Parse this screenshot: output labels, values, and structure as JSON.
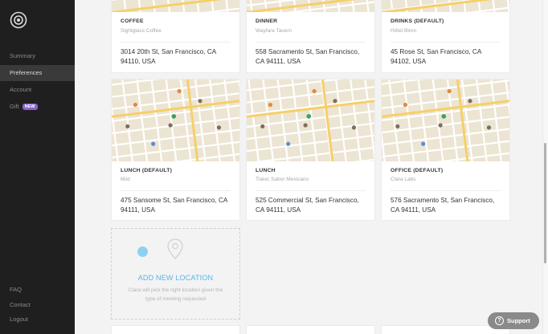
{
  "sidebar": {
    "items": [
      {
        "label": "Summary"
      },
      {
        "label": "Preferences"
      },
      {
        "label": "Account"
      },
      {
        "label": "Gift",
        "badge": "NEW"
      }
    ],
    "footer": [
      {
        "label": "FAQ"
      },
      {
        "label": "Contact"
      },
      {
        "label": "Logout"
      }
    ]
  },
  "locations": [
    {
      "title": "COFFEE",
      "name": "Sightglass Coffee",
      "address": "3014 20th St, San Francisco, CA 94110, USA"
    },
    {
      "title": "DINNER",
      "name": "Wayfare Tavern",
      "address": "558 Sacramento St, San Francisco, CA 94111, USA"
    },
    {
      "title": "DRINKS (DEFAULT)",
      "name": "Hôtel Biron",
      "address": "45 Rose St, San Francisco, CA 94102, USA"
    },
    {
      "title": "LUNCH (DEFAULT)",
      "name": "Mixt",
      "address": "475 Sansome St, San Francisco, CA 94111, USA"
    },
    {
      "title": "LUNCH",
      "name": "Tlaloc Sabor Mexicano",
      "address": "525 Commercial St, San Francisco, CA 94111, USA"
    },
    {
      "title": "OFFICE (DEFAULT)",
      "name": "Clara Labs",
      "address": "576 Sacramento St, San Francisco, CA 94111, USA"
    }
  ],
  "add_location": {
    "title": "ADD NEW LOCATION",
    "description": "Clara will pick the right location given the type of meeting requested"
  },
  "support": {
    "label": "Support"
  },
  "colors": {
    "accent": "#57b4e6",
    "badge": "#8a63c9",
    "sidebar": "#1f1f1f"
  }
}
